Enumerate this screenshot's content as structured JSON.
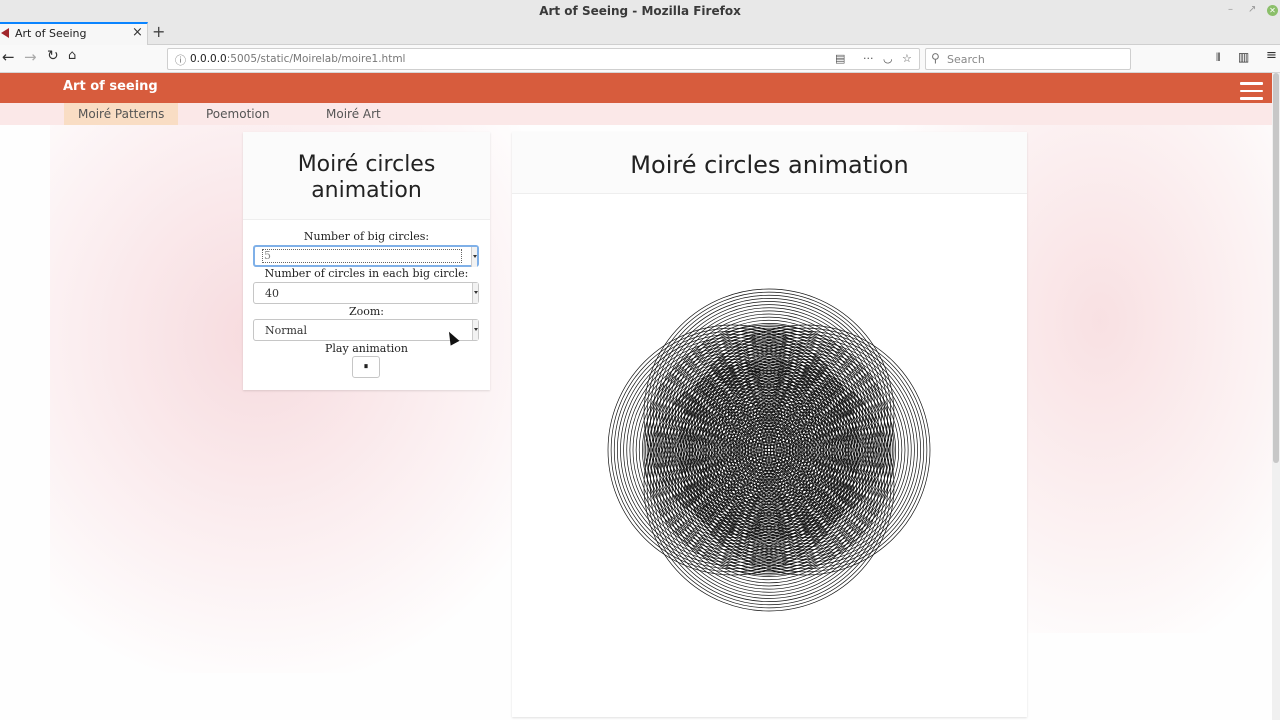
{
  "browser": {
    "window_title": "Art of Seeing - Mozilla Firefox",
    "tab_title": "Art of Seeing",
    "url_host": "0.0.0.0",
    "url_rest": ":5005/static/Moirelab/moire1.html",
    "search_placeholder": "Search"
  },
  "app": {
    "brand": "Art of seeing",
    "nav": [
      "Moiré Patterns",
      "Poemotion",
      "Moiré Art"
    ]
  },
  "controls": {
    "title": "Moiré circles animation",
    "big_circles_label": "Number of big circles:",
    "big_circles_value": "5",
    "circles_each_label": "Number of circles in each big circle:",
    "circles_each_value": "40",
    "zoom_label": "Zoom:",
    "zoom_value": "Normal",
    "play_label": "Play animation",
    "play_icon": "⏸"
  },
  "canvas": {
    "title": "Moiré circles animation",
    "big_circles": 5,
    "rings_per_circle": 40
  }
}
